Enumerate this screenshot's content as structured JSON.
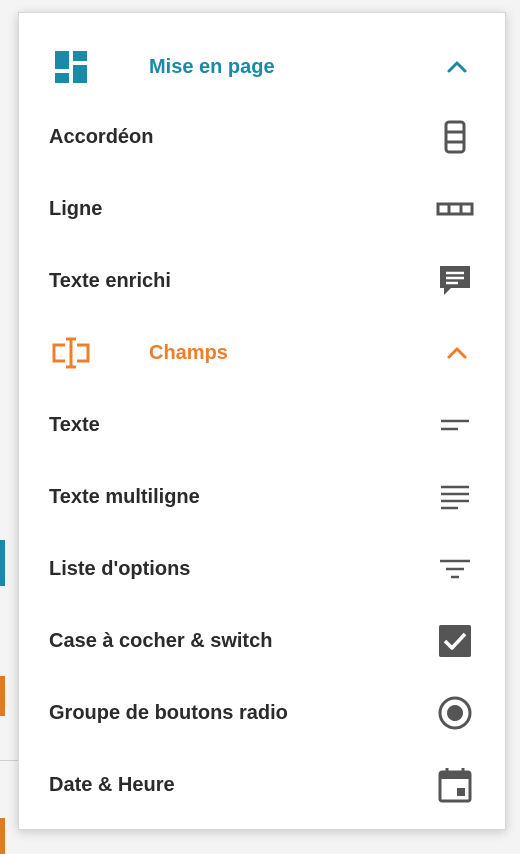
{
  "colors": {
    "layout_accent": "#1a8aa6",
    "fields_accent": "#f07d28",
    "item_text": "#2b2b2b",
    "item_icon": "#555555"
  },
  "layout_section": {
    "label": "Mise en page",
    "icon": "dashboard-icon",
    "expanded": true,
    "items": [
      {
        "label": "Accordéon",
        "icon": "accordion-icon"
      },
      {
        "label": "Ligne",
        "icon": "row-icon"
      },
      {
        "label": "Texte enrichi",
        "icon": "comment-icon"
      }
    ]
  },
  "fields_section": {
    "label": "Champs",
    "icon": "text-field-icon",
    "expanded": true,
    "items": [
      {
        "label": "Texte",
        "icon": "short-text-icon"
      },
      {
        "label": "Texte multiligne",
        "icon": "notes-icon"
      },
      {
        "label": "Liste d'options",
        "icon": "filter-list-icon"
      },
      {
        "label": "Case à cocher & switch",
        "icon": "checkbox-icon"
      },
      {
        "label": "Groupe de boutons radio",
        "icon": "radio-button-icon"
      },
      {
        "label": "Date & Heure",
        "icon": "calendar-icon"
      }
    ]
  }
}
